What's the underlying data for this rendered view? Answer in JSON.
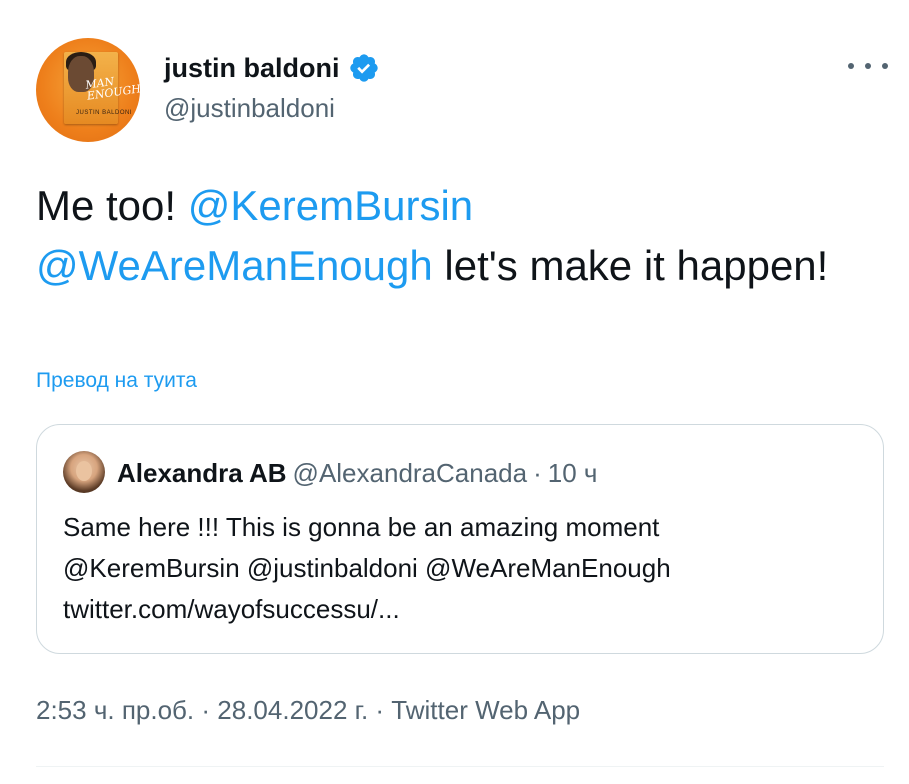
{
  "author": {
    "display_name": "justin baldoni",
    "handle": "@justinbaldoni",
    "avatar_icon": "book-cover-avatar",
    "avatar_book_title": "MAN ENOUGH",
    "avatar_book_author": "JUSTIN BALDONI",
    "verified": true
  },
  "tweet": {
    "text_prefix": "Me too! ",
    "mention_1": "@KeremBursin",
    "mention_2": "@WeAreManEnough",
    "text_suffix": "  let's make it happen!",
    "translate_label": "Превод на туита"
  },
  "quoted_tweet": {
    "name": "Alexandra AB",
    "handle": "@AlexandraCanada",
    "separator": "·",
    "time": "10 ч",
    "text_line_1": "Same here !!! This is gonna be an amazing moment",
    "text_line_2": "@KeremBursin @justinbaldoni @WeAreManEnough",
    "text_line_3": "twitter.com/wayofsuccessu/..."
  },
  "meta": {
    "time": "2:53 ч. пр.об.",
    "separator_1": " · ",
    "date": "28.04.2022 г.",
    "separator_2": " · ",
    "source": "Twitter Web App"
  },
  "colors": {
    "accent": "#1d9bf0",
    "text": "#0f1419",
    "secondary": "#536471",
    "border": "#cfd9de"
  }
}
